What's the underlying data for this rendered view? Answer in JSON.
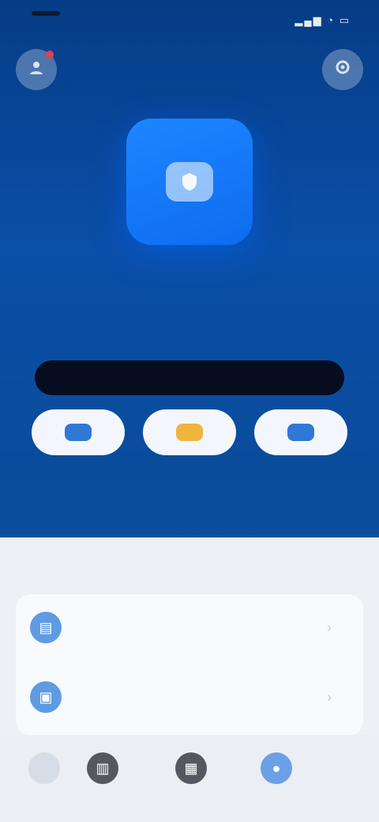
{
  "status_bar": {
    "time": "",
    "icons": "▂▄▆ ◔ ▭"
  },
  "header": {
    "avatar_icon": "person-icon",
    "settings_icon": "gear-icon"
  },
  "hero": {
    "tile_icon": "shield-icon",
    "title": "",
    "subtitle": "",
    "primary_button": "",
    "note": ""
  },
  "quick_actions": [
    {
      "label": "",
      "icon": "card-icon"
    },
    {
      "label": "",
      "icon": "coin-icon"
    },
    {
      "label": "",
      "icon": "send-icon"
    }
  ],
  "sheet": {
    "section_label": "",
    "rows": [
      {
        "label": "",
        "icon": "document-icon"
      },
      {
        "label": "",
        "icon": "lock-icon"
      }
    ]
  },
  "tab_bar": {
    "tabs": [
      {
        "label": "",
        "icon": "home-icon"
      },
      {
        "label": "",
        "icon": "chart-icon"
      },
      {
        "label": "",
        "icon": "grid-icon"
      },
      {
        "label": "",
        "icon": "user-icon"
      }
    ]
  },
  "colors": {
    "hero_blue": "#0a4fa8",
    "accent_blue": "#1e86ff",
    "primary_button": "#060d1e"
  }
}
